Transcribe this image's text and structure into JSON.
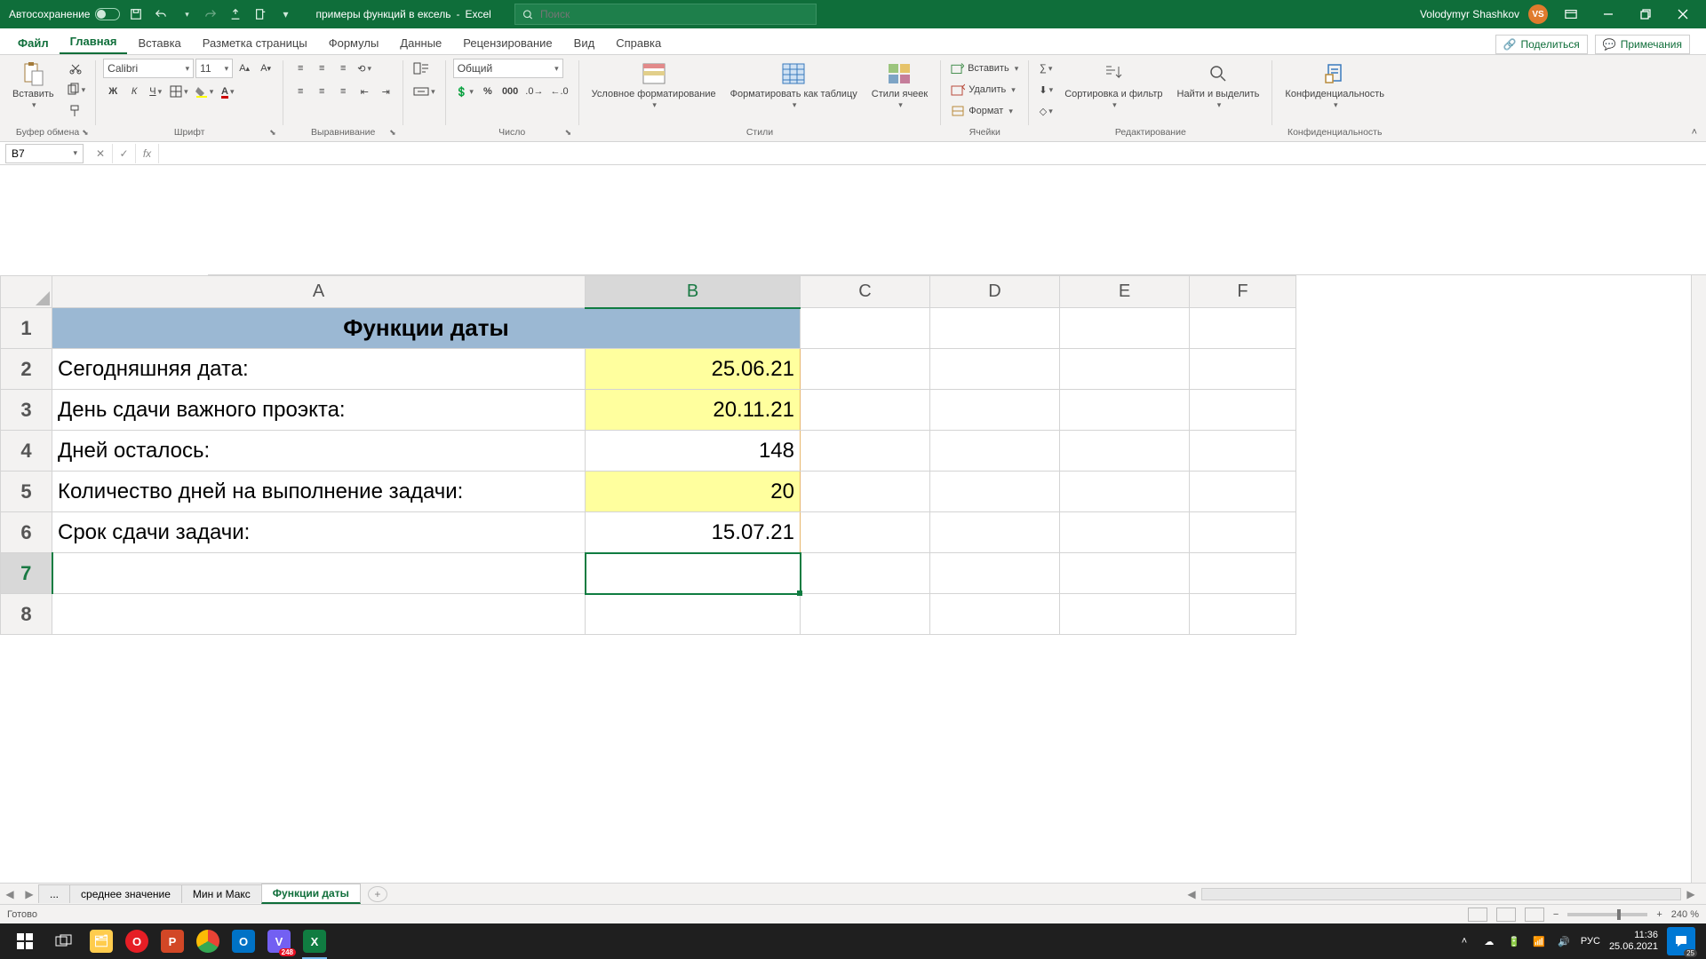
{
  "title": {
    "autosave": "Автосохранение",
    "doc": "примеры функций в ексель",
    "app": "Excel",
    "search_placeholder": "Поиск",
    "user": "Volodymyr Shashkov",
    "initials": "VS"
  },
  "tabs": {
    "file": "Файл",
    "home": "Главная",
    "insert": "Вставка",
    "layout": "Разметка страницы",
    "formulas": "Формулы",
    "data": "Данные",
    "review": "Рецензирование",
    "view": "Вид",
    "help": "Справка",
    "share": "Поделиться",
    "comments": "Примечания"
  },
  "ribbon": {
    "clipboard": {
      "paste": "Вставить",
      "group": "Буфер обмена"
    },
    "font": {
      "name": "Calibri",
      "size": "11",
      "group": "Шрифт"
    },
    "align": {
      "group": "Выравнивание"
    },
    "number": {
      "format": "Общий",
      "group": "Число"
    },
    "styles": {
      "cond": "Условное форматирование",
      "table": "Форматировать как таблицу",
      "cell": "Стили ячеек",
      "group": "Стили"
    },
    "cells": {
      "insert": "Вставить",
      "delete": "Удалить",
      "format": "Формат",
      "group": "Ячейки"
    },
    "editing": {
      "sort": "Сортировка и фильтр",
      "find": "Найти и выделить",
      "group": "Редактирование"
    },
    "sensitivity": {
      "label": "Конфиденциальность",
      "group": "Конфиденциальность"
    }
  },
  "namebox": "B7",
  "columns": [
    "A",
    "B",
    "C",
    "D",
    "E",
    "F"
  ],
  "rows": [
    "1",
    "2",
    "3",
    "4",
    "5",
    "6",
    "7",
    "8"
  ],
  "cells": {
    "r1": {
      "a": "Функции даты"
    },
    "r2": {
      "a": "Сегодняшняя дата:",
      "b": "25.06.21"
    },
    "r3": {
      "a": "День сдачи важного проэкта:",
      "b": "20.11.21"
    },
    "r4": {
      "a": "Дней осталось:",
      "b": "148"
    },
    "r5": {
      "a": "Количество дней на выполнение задачи:",
      "b": "20"
    },
    "r6": {
      "a": "Срок сдачи задачи:",
      "b": "15.07.21"
    }
  },
  "sheets": {
    "dots": "...",
    "s1": "среднее значение",
    "s2": "Мин и Макс",
    "s3": "Функции даты"
  },
  "status": {
    "ready": "Готово",
    "zoom": "240 %"
  },
  "taskbar": {
    "lang": "РУС",
    "time": "11:36",
    "date": "25.06.2021",
    "notif": "25",
    "viber_badge": "248"
  }
}
